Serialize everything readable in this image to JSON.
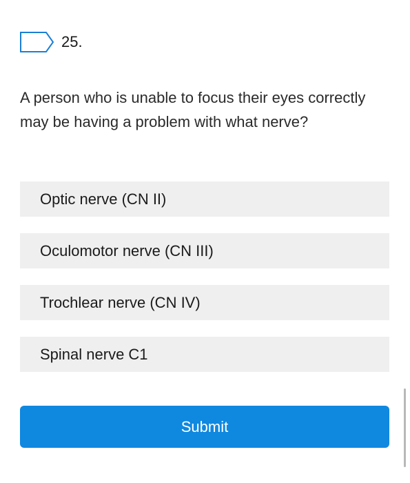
{
  "question": {
    "number": "25.",
    "text": "A person who is unable to focus their eyes correctly may be having a problem with what nerve?"
  },
  "options": [
    {
      "label": "Optic nerve (CN II)"
    },
    {
      "label": "Oculomotor nerve (CN III)"
    },
    {
      "label": "Trochlear nerve (CN IV)"
    },
    {
      "label": "Spinal nerve C1"
    }
  ],
  "submit": {
    "label": "Submit"
  },
  "colors": {
    "accent": "#0f88e0",
    "flag_outline": "#1a7fd4",
    "option_bg": "#efefef"
  },
  "icons": {
    "flag": "bookmark-flag-icon"
  }
}
